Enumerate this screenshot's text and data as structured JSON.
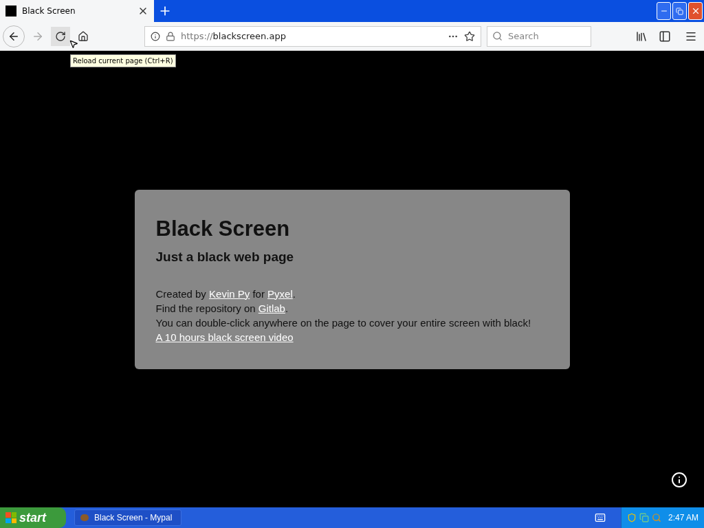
{
  "browser": {
    "tab": {
      "title": "Black Screen",
      "selected": true
    },
    "address": {
      "scheme": "https://",
      "host": "blackscreen.app"
    },
    "search": {
      "placeholder": "Search"
    },
    "back_disabled": false,
    "forward_disabled": true,
    "tooltip": "Reload current page (Ctrl+R)"
  },
  "card": {
    "title": "Black Screen",
    "subtitle": "Just a black web page",
    "lines": [
      [
        {
          "kind": "text",
          "text": "Created by "
        },
        {
          "kind": "link",
          "text": "Kevin Py"
        },
        {
          "kind": "text",
          "text": " for "
        },
        {
          "kind": "link",
          "text": "Pyxel"
        },
        {
          "kind": "text",
          "text": "."
        }
      ],
      [
        {
          "kind": "text",
          "text": "Find the repository on "
        },
        {
          "kind": "link",
          "text": "Gitlab"
        },
        {
          "kind": "text",
          "text": "."
        }
      ],
      [
        {
          "kind": "text",
          "text": "You can double-click anywhere on the page to cover your entire screen with black!"
        }
      ],
      [
        {
          "kind": "link",
          "text": "A 10 hours black screen video"
        }
      ]
    ]
  },
  "taskbar": {
    "start": "start",
    "task": "Black Screen - Mypal",
    "clock": "2:47 AM"
  }
}
